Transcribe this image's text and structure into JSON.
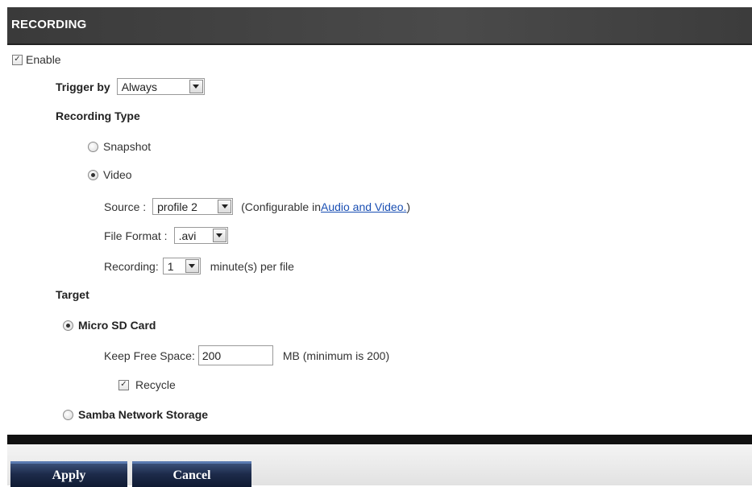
{
  "header": {
    "title": "RECORDING"
  },
  "enable": {
    "label": "Enable",
    "checked": true
  },
  "trigger": {
    "label": "Trigger by",
    "value": "Always"
  },
  "recording_type": {
    "label": "Recording Type",
    "snapshot_label": "Snapshot",
    "video_label": "Video",
    "selected": "Video"
  },
  "source": {
    "label": "Source :",
    "value": "profile 2",
    "note_prefix": "(Configurable in ",
    "link_text": "Audio and Video.",
    "note_suffix": ")"
  },
  "file_format": {
    "label": "File Format :",
    "value": ".avi"
  },
  "recording_length": {
    "label": "Recording:",
    "value": "1",
    "suffix": "minute(s) per file"
  },
  "target": {
    "label": "Target",
    "sd_label": "Micro SD Card",
    "samba_label": "Samba Network Storage",
    "selected": "Micro SD Card"
  },
  "free_space": {
    "label": "Keep Free Space:",
    "value": "200",
    "note": "MB (minimum is 200)"
  },
  "recycle": {
    "label": "Recycle",
    "checked": true
  },
  "buttons": {
    "apply": "Apply",
    "cancel": "Cancel"
  },
  "colors": {
    "header_bg": "#3a3a3a",
    "button_bg": "#1d2b4a",
    "link": "#1a4fb3"
  },
  "icons": {
    "check": "check-icon",
    "dropdown": "chevron-down-icon"
  }
}
